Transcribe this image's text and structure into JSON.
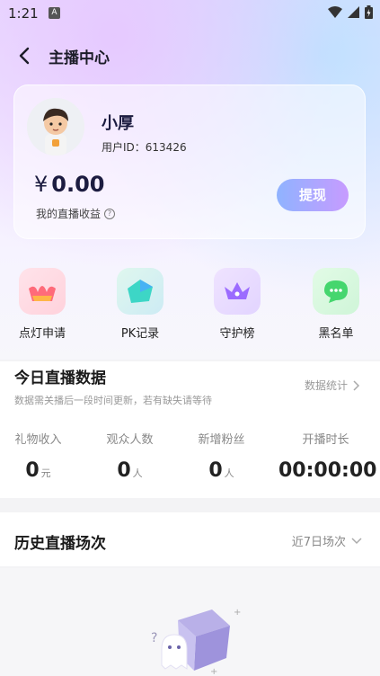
{
  "status_bar": {
    "time": "1:21",
    "notif_badge": "A"
  },
  "header": {
    "title": "主播中心"
  },
  "profile": {
    "name": "小厚",
    "user_id": "用户ID：613426",
    "currency_symbol": "¥",
    "earnings": "0.00",
    "earnings_label": "我的直播收益",
    "withdraw_label": "提现"
  },
  "quick_actions": [
    {
      "label": "点灯申请",
      "icon": "lantern-icon"
    },
    {
      "label": "PK记录",
      "icon": "pk-record-icon"
    },
    {
      "label": "守护榜",
      "icon": "crown-icon"
    },
    {
      "label": "黑名单",
      "icon": "blacklist-chat-icon"
    }
  ],
  "today": {
    "title": "今日直播数据",
    "subtitle": "数据需关播后一段时间更新，若有缺失请等待",
    "stats_link": "数据统计",
    "stats": [
      {
        "label": "礼物收入",
        "value": "0",
        "unit": "元"
      },
      {
        "label": "观众人数",
        "value": "0",
        "unit": "人"
      },
      {
        "label": "新增粉丝",
        "value": "0",
        "unit": "人"
      },
      {
        "label": "开播时长",
        "value": "00:00:00",
        "unit": ""
      }
    ]
  },
  "history": {
    "title": "历史直播场次",
    "filter_label": "近7日场次"
  }
}
